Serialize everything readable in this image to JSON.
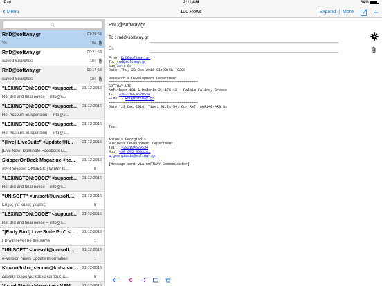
{
  "status": {
    "carrier": "iPad",
    "time": "2:11 AM",
    "battery": "84%"
  },
  "nav": {
    "back_label": "Menu",
    "title": "100 Rows",
    "expand_label": "Expand",
    "separator": "|",
    "more_label": "More",
    "plus_label": "+"
  },
  "search": {
    "placeholder": ""
  },
  "list": [
    {
      "from": "RnD@softway.gr",
      "date": "01:29:58",
      "subject": "Ss",
      "size": "104",
      "clip": true,
      "style": "selected"
    },
    {
      "from": "RnD@softway.gr",
      "date": "00:21:58",
      "subject": "Saved Searches",
      "size": "104",
      "clip": true,
      "style": "normal"
    },
    {
      "from": "RnD@softway.gr",
      "date": "00:17:58",
      "subject": "Saved Searches",
      "size": "104",
      "clip": true,
      "style": "alt"
    },
    {
      "from": "\"LEXINGTON:CODE\" <support...",
      "date": "21-12-2016",
      "subject": "Re: 3rd and final notice -- info@s...",
      "size": "",
      "clip": false,
      "style": "normal"
    },
    {
      "from": "\"LEXINGTON:CODE\" <support...",
      "date": "21-12-2016",
      "subject": "Re: Account Suspension -- info@s...",
      "size": "",
      "clip": false,
      "style": "alt"
    },
    {
      "from": "\"LEXINGTON:CODE\" <support...",
      "date": "21-12-2016",
      "subject": "Re: Account Suspension -- info@s...",
      "size": "",
      "clip": false,
      "style": "normal"
    },
    {
      "from": "\"{live} LiveSuite\" <update@li...",
      "date": "21-12-2016",
      "subject": "[Live Now] Dominate Facebook Li...",
      "size": "",
      "clip": false,
      "style": "alt"
    },
    {
      "from": "SkipperOnDeck Magazine <ne...",
      "date": "21-12-2016",
      "subject": "#044 Skipper ONDECK | Winter Is...",
      "size": "6",
      "clip": false,
      "style": "normal"
    },
    {
      "from": "\"LEXINGTON:CODE\" <support...",
      "date": "21-12-2016",
      "subject": "Re: 3rd and final notice -- info@s...",
      "size": "",
      "clip": false,
      "style": "alt"
    },
    {
      "from": "\"UNISOFT\" <unisoft@unisoft....",
      "date": "21-12-2016",
      "subject": "Ευχές για καλές γιορτές",
      "size": "6",
      "clip": false,
      "style": "normal"
    },
    {
      "from": "\"LEXINGTON:CODE\" <support...",
      "date": "21-12-2016",
      "subject": "Re: 3rd and final notice -- info@s...",
      "size": "",
      "clip": false,
      "style": "alt"
    },
    {
      "from": "\"[Early Bird] Live Suite Pro\" <...",
      "date": "21-12-2016",
      "subject": "FB will never be the same",
      "size": "1",
      "clip": false,
      "style": "normal"
    },
    {
      "from": "\"UNISOFT\" <unisoft@unisoft....",
      "date": "21-12-2016",
      "subject": "e-Version News Update Information",
      "size": "1",
      "clip": false,
      "style": "alt"
    },
    {
      "from": "Κυπσόβολος <ecom@kotsovol...",
      "date": "21-12-2016",
      "subject": "Διάλεξε δώρο για εσένα και τους α...",
      "size": "6",
      "clip": false,
      "style": "normal"
    },
    {
      "from": "Visual Studio Magazine <VSM...",
      "date": "21-12-2016",
      "subject": "",
      "size": "",
      "clip": false,
      "style": "alt"
    }
  ],
  "message": {
    "from": "RnD@softway.gr",
    "to": "To : rnd@softway.gr",
    "subject": "Ss",
    "header_lines": [
      {
        "label": "From: ",
        "link": "RnD@softway.gr"
      },
      {
        "label": "To: ",
        "link": "rnd@softway.gr"
      },
      {
        "label": "Subject: Ss",
        "link": ""
      },
      {
        "label": "Date: Thu, 22 Dec 2016 01:29:55 +0200",
        "link": ""
      }
    ],
    "signature_top": [
      "",
      "Research & Development Department",
      "===========================================",
      "SOFTWAY LTD",
      "Amfitheas 181 & Dodonis 2, 175 63 - Palaio Faliro, Greece"
    ],
    "tel_label": "TEL: ",
    "tel_link": "+30-210-4520534",
    "email_label": "E-Mail: ",
    "email_link": "RnD@softway.gr",
    "rule": "===========================================",
    "sent_line": "Date: 22 Dec 2016, Time: 01:29:54, Our Ref: 069149-ARG Ss",
    "body": "Test",
    "sig_name": "Antonis Georgiadis",
    "sig_dept": "Business Development Department",
    "sig_tel_label": "Tel.: ",
    "sig_tel": "+302104520534",
    "sig_mob_label": "Mob: ",
    "sig_mob": "+30 695 8633201",
    "sig_mail": "a.georgiadis@softway.gr",
    "footer": "[Message sent via SOFTWAY Communicator]"
  },
  "colors": {
    "accent": "#1e7cf2",
    "selected_row": "#b6d3f2",
    "link": "#0000ee"
  }
}
